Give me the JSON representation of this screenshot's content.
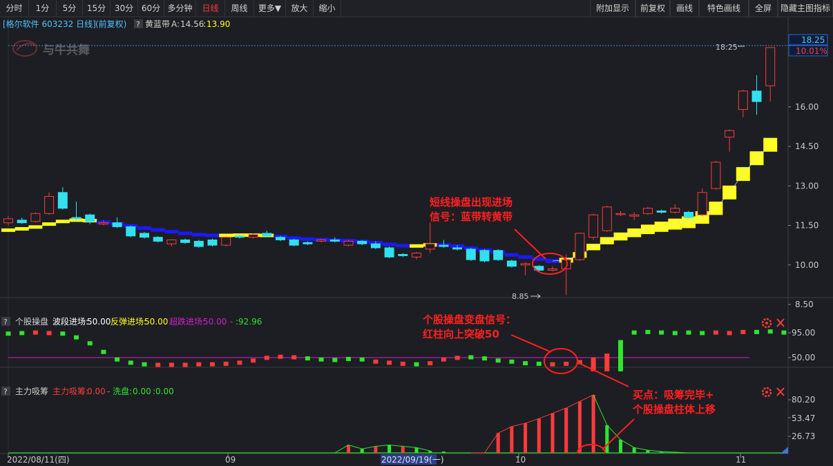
{
  "toolbar": {
    "left": [
      "分时",
      "1分",
      "5分",
      "15分",
      "30分",
      "60分",
      "多分钟",
      "日线",
      "周线",
      "更多▼",
      "放大",
      "缩小"
    ],
    "active": "日线",
    "right": [
      "附加显示",
      "前复权",
      "画线",
      "特色画线",
      "全屏",
      "隐藏主图指标"
    ]
  },
  "main": {
    "stock_label": "[格尔软件 603232 日线]",
    "adjust_label": "(前复权)",
    "help_mark": "?",
    "indicator_name": "黄蓝带",
    "indicator_a_label": "A:",
    "indicator_a_value": "14.56",
    "indicator_b_label": ":",
    "indicator_b_value": "13.90",
    "watermark": "与牛共舞",
    "price_high_badge": "18.25",
    "pct_badge": "10.01%",
    "high_label": "18:25",
    "low_label": "8.85",
    "y_ticks": [
      "16.00",
      "14.50",
      "13.00",
      "11.50",
      "10.00",
      "8.50"
    ],
    "annotation_1_line1": "短线操盘出现进场",
    "annotation_1_line2": "信号：蓝带转黄带"
  },
  "panel2": {
    "help_mark": "?",
    "title": "个股操盘",
    "legend_1_label": "波段进场:",
    "legend_1_value": "50.00",
    "legend_2_label": "反弹进场:",
    "legend_2_value": "50.00",
    "legend_3_label": "超跌进场:",
    "legend_3_value": "50.00",
    "legend_4_label": "-",
    "legend_4_value": ":92.96",
    "y_ticks": [
      "95.00",
      "50.00"
    ],
    "annotation_line1": "个股操盘变盘信号：",
    "annotation_line2": "红柱向上突破50"
  },
  "panel3": {
    "help_mark": "?",
    "title": "主力吸筹",
    "legend_1_label": "主力吸筹:",
    "legend_1_value": "0.00",
    "legend_2_label": "- 洗盘:",
    "legend_2_value": "0.00",
    "legend_3_value": ":0.00",
    "y_ticks": [
      "80.20",
      "53.47",
      "26.73"
    ],
    "annotation_line1": "买点：吸筹完毕+",
    "annotation_line2": "个股操盘柱体上移"
  },
  "x_axis": {
    "labels": [
      "2022/08/11(四)",
      "09",
      "2022/09/19(一)",
      "10",
      "11"
    ]
  },
  "colors": {
    "up": "#ff3b3b",
    "down": "#32e0f0",
    "yellow_band": "#ffff1a",
    "blue_band": "#1a1aff",
    "annotation": "#ff2020",
    "green": "#2ee62e",
    "magenta": "#d21fd2"
  },
  "chart_data": [
    {
      "type": "candlestick",
      "title": "格尔软件 603232 日线",
      "ylim": [
        8.5,
        18.3
      ],
      "ticks": [
        16.0,
        14.5,
        13.0,
        11.5,
        10.0,
        8.5
      ],
      "candles": [
        {
          "o": 11.6,
          "c": 11.75,
          "h": 11.85,
          "l": 11.5
        },
        {
          "o": 11.7,
          "c": 11.6,
          "h": 11.8,
          "l": 11.55
        },
        {
          "o": 11.65,
          "c": 11.95,
          "h": 12.0,
          "l": 11.6
        },
        {
          "o": 11.95,
          "c": 12.6,
          "h": 12.75,
          "l": 11.9
        },
        {
          "o": 12.75,
          "c": 12.15,
          "h": 12.95,
          "l": 12.1
        },
        {
          "o": 11.8,
          "c": 11.75,
          "h": 12.4,
          "l": 11.7
        },
        {
          "o": 11.9,
          "c": 11.65,
          "h": 11.95,
          "l": 11.55
        },
        {
          "o": 11.55,
          "c": 11.6,
          "h": 11.7,
          "l": 11.5
        },
        {
          "o": 11.6,
          "c": 11.45,
          "h": 11.8,
          "l": 11.4
        },
        {
          "o": 11.45,
          "c": 11.1,
          "h": 11.5,
          "l": 11.05
        },
        {
          "o": 11.2,
          "c": 11.05,
          "h": 11.25,
          "l": 11.0
        },
        {
          "o": 11.05,
          "c": 10.9,
          "h": 11.1,
          "l": 10.85
        },
        {
          "o": 10.8,
          "c": 10.95,
          "h": 10.98,
          "l": 10.7
        },
        {
          "o": 10.95,
          "c": 10.85,
          "h": 11.0,
          "l": 10.8
        },
        {
          "o": 10.9,
          "c": 10.7,
          "h": 10.95,
          "l": 10.65
        },
        {
          "o": 10.95,
          "c": 10.75,
          "h": 11.0,
          "l": 10.7
        },
        {
          "o": 10.75,
          "c": 11.05,
          "h": 11.08,
          "l": 10.7
        },
        {
          "o": 11.1,
          "c": 11.05,
          "h": 11.15,
          "l": 11.0
        },
        {
          "o": 11.05,
          "c": 11.15,
          "h": 11.2,
          "l": 11.0
        },
        {
          "o": 11.2,
          "c": 11.1,
          "h": 11.3,
          "l": 11.05
        },
        {
          "o": 11.05,
          "c": 10.95,
          "h": 11.1,
          "l": 10.9
        },
        {
          "o": 10.95,
          "c": 10.75,
          "h": 11.0,
          "l": 10.7
        },
        {
          "o": 10.85,
          "c": 10.8,
          "h": 10.9,
          "l": 10.75
        },
        {
          "o": 10.9,
          "c": 10.95,
          "h": 11.0,
          "l": 10.85
        },
        {
          "o": 10.95,
          "c": 10.9,
          "h": 11.05,
          "l": 10.85
        },
        {
          "o": 10.75,
          "c": 10.9,
          "h": 10.95,
          "l": 10.7
        },
        {
          "o": 10.9,
          "c": 10.8,
          "h": 10.95,
          "l": 10.75
        },
        {
          "o": 10.8,
          "c": 10.65,
          "h": 10.9,
          "l": 10.6
        },
        {
          "o": 10.65,
          "c": 10.3,
          "h": 10.7,
          "l": 10.25
        },
        {
          "o": 10.4,
          "c": 10.35,
          "h": 10.45,
          "l": 10.3
        },
        {
          "o": 10.3,
          "c": 10.45,
          "h": 10.5,
          "l": 10.2
        },
        {
          "o": 10.6,
          "c": 10.8,
          "h": 11.6,
          "l": 10.45
        },
        {
          "o": 10.75,
          "c": 10.7,
          "h": 10.95,
          "l": 10.65
        },
        {
          "o": 10.65,
          "c": 10.6,
          "h": 10.75,
          "l": 10.55
        },
        {
          "o": 10.6,
          "c": 10.2,
          "h": 10.65,
          "l": 10.15
        },
        {
          "o": 10.55,
          "c": 10.15,
          "h": 10.6,
          "l": 10.1
        },
        {
          "o": 10.55,
          "c": 10.2,
          "h": 10.6,
          "l": 10.15
        },
        {
          "o": 10.15,
          "c": 9.95,
          "h": 10.2,
          "l": 9.9
        },
        {
          "o": 10.0,
          "c": 10.05,
          "h": 10.1,
          "l": 9.6
        },
        {
          "o": 9.95,
          "c": 9.8,
          "h": 10.0,
          "l": 9.75
        },
        {
          "o": 9.8,
          "c": 9.85,
          "h": 9.95,
          "l": 9.75
        },
        {
          "o": 9.85,
          "c": 10.2,
          "h": 10.4,
          "l": 8.85
        },
        {
          "o": 10.2,
          "c": 11.2,
          "h": 11.22,
          "l": 10.15
        },
        {
          "o": 11.05,
          "c": 11.9,
          "h": 11.95,
          "l": 10.95
        },
        {
          "o": 11.3,
          "c": 12.2,
          "h": 12.25,
          "l": 11.25
        },
        {
          "o": 11.95,
          "c": 11.95,
          "h": 12.05,
          "l": 11.85
        },
        {
          "o": 11.85,
          "c": 11.9,
          "h": 12.0,
          "l": 11.7
        },
        {
          "o": 11.95,
          "c": 12.15,
          "h": 12.2,
          "l": 11.9
        },
        {
          "o": 12.05,
          "c": 12.0,
          "h": 12.1,
          "l": 11.95
        },
        {
          "o": 12.0,
          "c": 12.15,
          "h": 12.3,
          "l": 11.95
        },
        {
          "o": 12.0,
          "c": 11.8,
          "h": 12.05,
          "l": 11.75
        },
        {
          "o": 11.9,
          "c": 12.75,
          "h": 12.9,
          "l": 11.85
        },
        {
          "o": 12.9,
          "c": 13.9,
          "h": 13.95,
          "l": 12.85
        },
        {
          "o": 14.85,
          "c": 15.1,
          "h": 15.15,
          "l": 14.3
        },
        {
          "o": 15.9,
          "c": 16.6,
          "h": 16.65,
          "l": 15.6
        },
        {
          "o": 16.6,
          "c": 16.2,
          "h": 17.2,
          "l": 15.7
        },
        {
          "o": 16.8,
          "c": 18.25,
          "h": 18.25,
          "l": 16.2
        }
      ],
      "band": [
        {
          "v": 11.32,
          "c": "y"
        },
        {
          "v": 11.37,
          "c": "y"
        },
        {
          "v": 11.44,
          "c": "y"
        },
        {
          "v": 11.55,
          "c": "y"
        },
        {
          "v": 11.65,
          "c": "y"
        },
        {
          "v": 11.7,
          "c": "y"
        },
        {
          "v": 11.68,
          "c": "y"
        },
        {
          "v": 11.62,
          "c": "b"
        },
        {
          "v": 11.56,
          "c": "b"
        },
        {
          "v": 11.48,
          "c": "b"
        },
        {
          "v": 11.4,
          "c": "b"
        },
        {
          "v": 11.33,
          "c": "b"
        },
        {
          "v": 11.26,
          "c": "b"
        },
        {
          "v": 11.2,
          "c": "b"
        },
        {
          "v": 11.15,
          "c": "b"
        },
        {
          "v": 11.12,
          "c": "b"
        },
        {
          "v": 11.12,
          "c": "y"
        },
        {
          "v": 11.13,
          "c": "y"
        },
        {
          "v": 11.13,
          "c": "y"
        },
        {
          "v": 11.12,
          "c": "y"
        },
        {
          "v": 11.08,
          "c": "b"
        },
        {
          "v": 11.02,
          "c": "b"
        },
        {
          "v": 10.98,
          "c": "b"
        },
        {
          "v": 10.96,
          "c": "b"
        },
        {
          "v": 10.94,
          "c": "b"
        },
        {
          "v": 10.92,
          "c": "b"
        },
        {
          "v": 10.89,
          "c": "b"
        },
        {
          "v": 10.84,
          "c": "b"
        },
        {
          "v": 10.78,
          "c": "b"
        },
        {
          "v": 10.73,
          "c": "b"
        },
        {
          "v": 10.72,
          "c": "y"
        },
        {
          "v": 10.76,
          "c": "y"
        },
        {
          "v": 10.76,
          "c": "b"
        },
        {
          "v": 10.72,
          "c": "b"
        },
        {
          "v": 10.64,
          "c": "b"
        },
        {
          "v": 10.56,
          "c": "b"
        },
        {
          "v": 10.48,
          "c": "b"
        },
        {
          "v": 10.38,
          "c": "b"
        },
        {
          "v": 10.3,
          "c": "b"
        },
        {
          "v": 10.22,
          "c": "b"
        },
        {
          "v": 10.15,
          "c": "b"
        },
        {
          "v": 10.18,
          "c": "y"
        },
        {
          "v": 10.38,
          "c": "y"
        },
        {
          "v": 10.68,
          "c": "y"
        },
        {
          "v": 10.92,
          "c": "y"
        },
        {
          "v": 11.08,
          "c": "y"
        },
        {
          "v": 11.22,
          "c": "y"
        },
        {
          "v": 11.35,
          "c": "y"
        },
        {
          "v": 11.45,
          "c": "y"
        },
        {
          "v": 11.55,
          "c": "y"
        },
        {
          "v": 11.62,
          "c": "y"
        },
        {
          "v": 11.8,
          "c": "y"
        },
        {
          "v": 12.15,
          "c": "y"
        },
        {
          "v": 12.75,
          "c": "y"
        },
        {
          "v": 13.45,
          "c": "y"
        },
        {
          "v": 14.05,
          "c": "y"
        },
        {
          "v": 14.56,
          "c": "y"
        }
      ]
    },
    {
      "type": "dot",
      "title": "个股操盘",
      "ylim": [
        0,
        100
      ],
      "threshold": 50,
      "values": [
        92,
        93,
        94,
        93,
        92,
        85,
        74,
        58,
        44,
        38,
        35,
        34,
        34,
        34,
        35,
        35,
        36,
        38,
        42,
        47,
        49,
        48,
        46,
        44,
        43,
        45,
        44,
        40,
        38,
        36,
        35,
        37,
        44,
        47,
        48,
        46,
        42,
        40,
        37,
        36,
        35,
        36,
        39,
        48,
        55,
        80,
        94,
        95,
        94,
        93,
        94,
        93,
        94,
        93,
        95,
        95,
        96,
        94
      ],
      "colors": [
        "g",
        "g",
        "r",
        "r",
        "g",
        "g",
        "g",
        "g",
        "g",
        "g",
        "g",
        "r",
        "r",
        "r",
        "r",
        "r",
        "r",
        "r",
        "r",
        "r",
        "r",
        "r",
        "g",
        "g",
        "g",
        "g",
        "g",
        "r",
        "r",
        "r",
        "g",
        "r",
        "r",
        "r",
        "g",
        "g",
        "g",
        "g",
        "g",
        "g",
        "r",
        "r",
        "r",
        "r",
        "r",
        "g",
        "g",
        "g",
        "g",
        "g",
        "g",
        "g",
        "r",
        "r",
        "r",
        "g",
        "g",
        "g"
      ]
    },
    {
      "type": "bar",
      "title": "主力吸筹",
      "ylim": [
        0,
        90
      ],
      "ticks": [
        80.2,
        53.47,
        26.73
      ],
      "values": [
        0,
        0,
        0,
        0,
        0,
        0,
        0,
        0,
        0,
        0,
        0,
        0,
        0,
        0,
        0,
        0,
        0,
        0,
        0,
        0,
        0,
        0,
        0,
        0,
        0,
        12,
        6,
        10,
        12,
        10,
        8,
        3,
        2,
        0,
        0,
        0,
        30,
        40,
        45,
        52,
        60,
        68,
        78,
        88,
        42,
        20,
        8,
        4,
        2,
        1,
        0,
        0,
        0,
        0,
        0,
        0,
        0,
        0
      ],
      "colors": [
        "r",
        "r",
        "r",
        "r",
        "r",
        "r",
        "r",
        "r",
        "r",
        "r",
        "r",
        "r",
        "r",
        "r",
        "r",
        "r",
        "r",
        "r",
        "r",
        "r",
        "r",
        "r",
        "r",
        "r",
        "r",
        "r",
        "g",
        "r",
        "g",
        "r",
        "g",
        "g",
        "g",
        "g",
        "g",
        "g",
        "r",
        "r",
        "r",
        "r",
        "r",
        "r",
        "r",
        "r",
        "g",
        "g",
        "g",
        "g",
        "g",
        "g",
        "g",
        "g",
        "g",
        "g",
        "g",
        "g",
        "g",
        "g"
      ]
    }
  ]
}
